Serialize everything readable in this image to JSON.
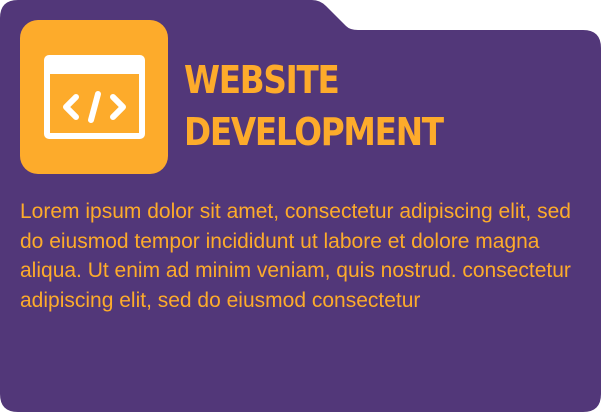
{
  "colors": {
    "card_background": "#523779",
    "accent": "#FDAB2B",
    "icon_line": "#FFFFFF"
  },
  "icon": "code-window-icon",
  "title": {
    "line1": "WEBSITE",
    "line2": "DEVELOPMENT"
  },
  "body": "Lorem ipsum dolor sit amet, consectetur adipiscing elit, sed do eiusmod tempor incididunt ut labore et dolore magna aliqua. Ut enim ad minim veniam, quis nostrud. consectetur adipiscing elit, sed do eiusmod consectetur"
}
